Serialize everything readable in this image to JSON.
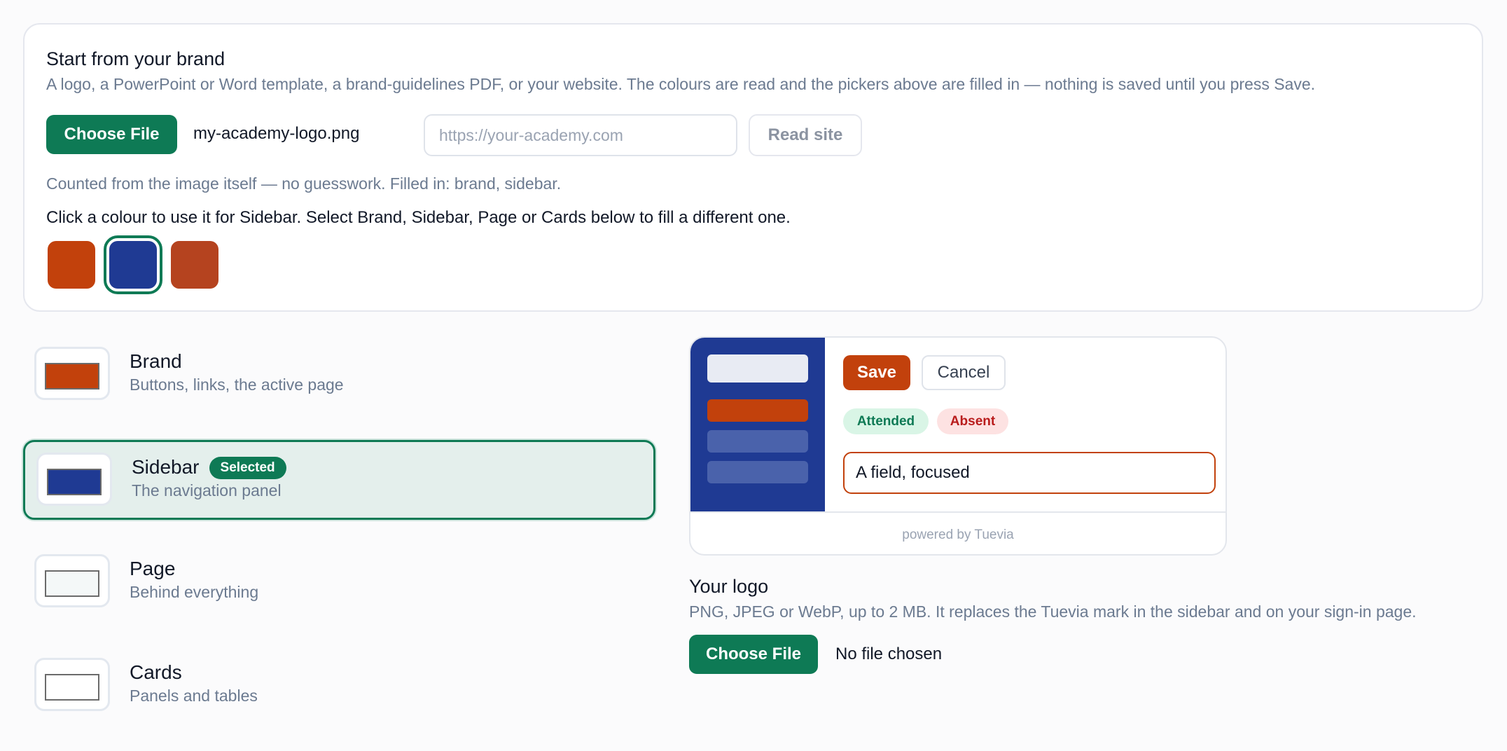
{
  "brand_import": {
    "title": "Start from your brand",
    "description": "A logo, a PowerPoint or Word template, a brand-guidelines PDF, or your website. The colours are read and the pickers above are filled in — nothing is saved until you press Save.",
    "choose_file_label": "Choose File",
    "file_name": "my-academy-logo.png",
    "url_placeholder": "https://your-academy.com",
    "read_site_label": "Read site",
    "status": "Counted from the image itself — no guesswork. Filled in: brand, sidebar.",
    "instruction": "Click a colour to use it for Sidebar. Select Brand, Sidebar, Page or Cards below to fill a different one.",
    "swatches": [
      "#c2410c",
      "#1f3a93",
      "#b5431f"
    ],
    "selected_swatch": 1
  },
  "color_targets": [
    {
      "title": "Brand",
      "description": "Buttons, links, the active page",
      "color": "#c2410c",
      "selected": false
    },
    {
      "title": "Sidebar",
      "description": "The navigation panel",
      "color": "#1f3a93",
      "selected": true,
      "badge": "Selected"
    },
    {
      "title": "Page",
      "description": "Behind everything",
      "color": "#f4f8f8",
      "selected": false
    },
    {
      "title": "Cards",
      "description": "Panels and tables",
      "color": "#ffffff",
      "selected": false
    }
  ],
  "preview": {
    "save_label": "Save",
    "cancel_label": "Cancel",
    "attended_label": "Attended",
    "absent_label": "Absent",
    "field_text": "A field, focused",
    "footer": "powered by Tuevia",
    "sidebar_color": "#1f3a93",
    "brand_color": "#c2410c"
  },
  "logo": {
    "title": "Your logo",
    "description": "PNG, JPEG or WebP, up to 2 MB. It replaces the Tuevia mark in the sidebar and on your sign-in page.",
    "choose_file_label": "Choose File",
    "file_status": "No file chosen"
  },
  "colors": {
    "accent_green": "#0e7a55"
  }
}
